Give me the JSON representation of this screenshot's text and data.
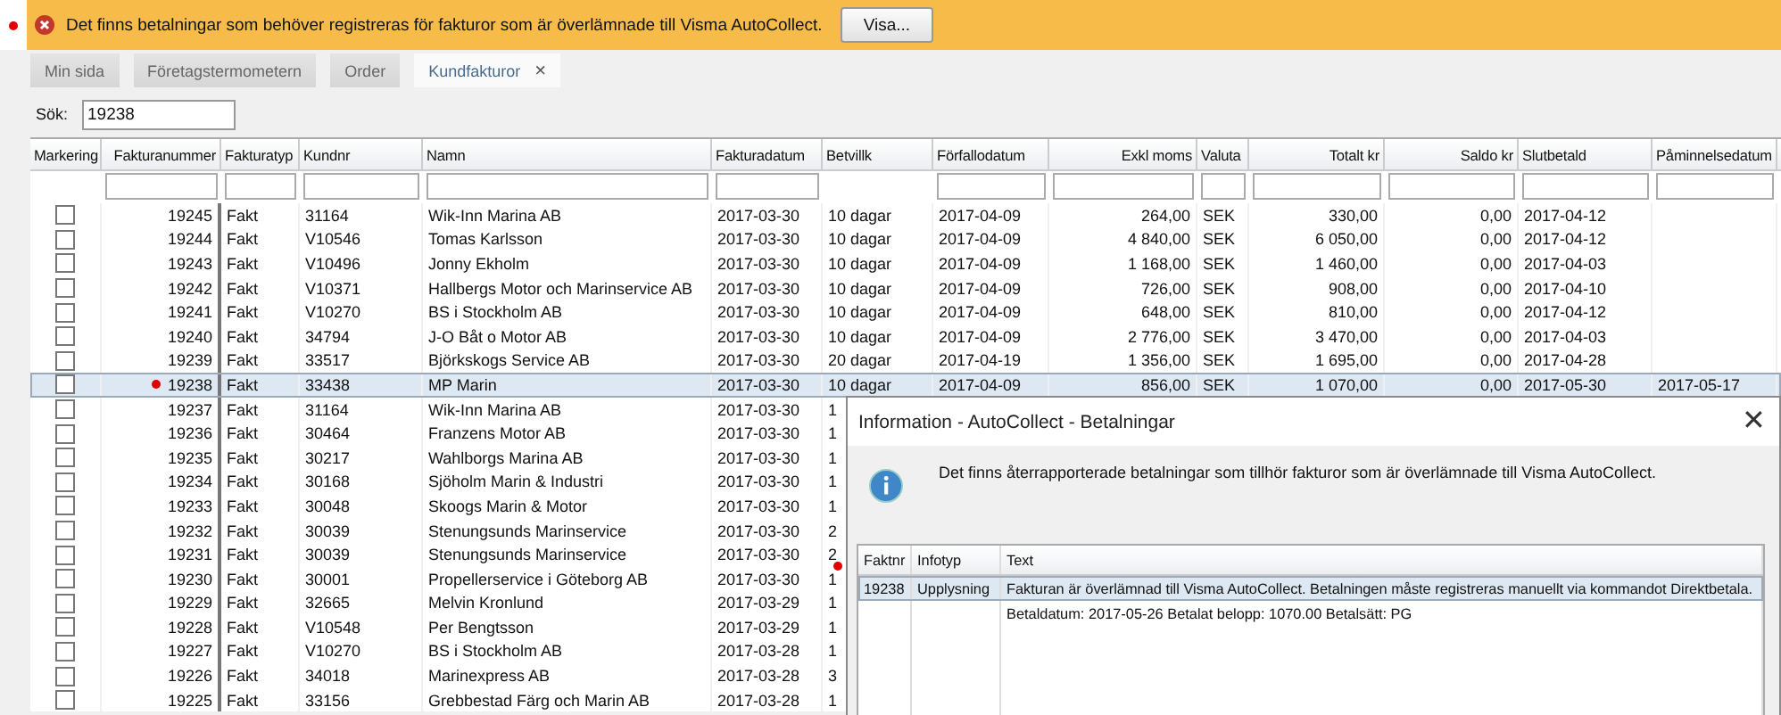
{
  "banner": {
    "flagged": true,
    "message": "Det finns betalningar som behöver registreras för fakturor som är överlämnade till Visma AutoCollect.",
    "button": "Visa..."
  },
  "tabs": [
    {
      "label": "Min sida",
      "selected": false
    },
    {
      "label": "Företagstermometern",
      "selected": false
    },
    {
      "label": "Order",
      "selected": false
    },
    {
      "label": "Kundfakturor",
      "selected": true,
      "close": "×"
    }
  ],
  "search": {
    "label": "Sök:",
    "value": "19238"
  },
  "table": {
    "check_column": "Markering",
    "columns": [
      {
        "label": "Fakturanummer",
        "kind": "number",
        "filter": true
      },
      {
        "label": "Fakturatyp",
        "kind": "text",
        "filter": true
      },
      {
        "label": "Kundnr",
        "kind": "text",
        "filter": true
      },
      {
        "label": "Namn",
        "kind": "text",
        "filter": true
      },
      {
        "label": "Fakturadatum",
        "kind": "text",
        "filter": true
      },
      {
        "label": "Betvillk",
        "kind": "text",
        "filter": false
      },
      {
        "label": "Förfallodatum",
        "kind": "text",
        "filter": true
      },
      {
        "label": "Exkl moms",
        "kind": "number",
        "filter": true
      },
      {
        "label": "Valuta",
        "kind": "text",
        "filter": true
      },
      {
        "label": "Totalt kr",
        "kind": "number",
        "filter": true
      },
      {
        "label": "Saldo kr",
        "kind": "number",
        "filter": true
      },
      {
        "label": "Slutbetald",
        "kind": "text",
        "filter": true
      },
      {
        "label": "Påminnelsedatum",
        "kind": "text",
        "filter": true
      }
    ],
    "rows": [
      {
        "checked": false,
        "selected": false,
        "flagged": false,
        "cells": [
          "19245",
          "Fakt",
          "31164",
          "Wik-Inn Marina AB",
          "2017-03-30",
          "10 dagar",
          "2017-04-09",
          "264,00",
          "SEK",
          "330,00",
          "0,00",
          "2017-04-12"
        ]
      },
      {
        "checked": false,
        "selected": false,
        "flagged": false,
        "cells": [
          "19244",
          "Fakt",
          "V10546",
          "Tomas Karlsson",
          "2017-03-30",
          "10 dagar",
          "2017-04-09",
          "4 840,00",
          "SEK",
          "6 050,00",
          "0,00",
          "2017-04-12"
        ]
      },
      {
        "checked": false,
        "selected": false,
        "flagged": false,
        "cells": [
          "19243",
          "Fakt",
          "V10496",
          "Jonny Ekholm",
          "2017-03-30",
          "10 dagar",
          "2017-04-09",
          "1 168,00",
          "SEK",
          "1 460,00",
          "0,00",
          "2017-04-03"
        ]
      },
      {
        "checked": false,
        "selected": false,
        "flagged": false,
        "cells": [
          "19242",
          "Fakt",
          "V10371",
          "Hallbergs Motor och Marinservice AB",
          "2017-03-30",
          "10 dagar",
          "2017-04-09",
          "726,00",
          "SEK",
          "908,00",
          "0,00",
          "2017-04-10"
        ]
      },
      {
        "checked": false,
        "selected": false,
        "flagged": false,
        "cells": [
          "19241",
          "Fakt",
          "V10270",
          "BS i Stockholm AB",
          "2017-03-30",
          "10 dagar",
          "2017-04-09",
          "648,00",
          "SEK",
          "810,00",
          "0,00",
          "2017-04-12"
        ]
      },
      {
        "checked": false,
        "selected": false,
        "flagged": false,
        "cells": [
          "19240",
          "Fakt",
          "34794",
          "J-O Båt o Motor AB",
          "2017-03-30",
          "10 dagar",
          "2017-04-09",
          "2 776,00",
          "SEK",
          "3 470,00",
          "0,00",
          "2017-04-03"
        ]
      },
      {
        "checked": false,
        "selected": false,
        "flagged": false,
        "cells": [
          "19239",
          "Fakt",
          "33517",
          "Björkskogs Service AB",
          "2017-03-30",
          "20 dagar",
          "2017-04-19",
          "1 356,00",
          "SEK",
          "1 695,00",
          "0,00",
          "2017-04-28"
        ]
      },
      {
        "checked": false,
        "selected": true,
        "flagged": true,
        "cells": [
          "19238",
          "Fakt",
          "33438",
          "MP Marin",
          "2017-03-30",
          "10 dagar",
          "2017-04-09",
          "856,00",
          "SEK",
          "1 070,00",
          "0,00",
          "2017-05-30",
          "2017-05-17"
        ]
      },
      {
        "checked": false,
        "selected": false,
        "flagged": false,
        "cells": [
          "19237",
          "Fakt",
          "31164",
          "Wik-Inn Marina AB",
          "2017-03-30",
          "1"
        ]
      },
      {
        "checked": false,
        "selected": false,
        "flagged": false,
        "cells": [
          "19236",
          "Fakt",
          "30464",
          "Franzens Motor AB",
          "2017-03-30",
          "1"
        ]
      },
      {
        "checked": false,
        "selected": false,
        "flagged": false,
        "cells": [
          "19235",
          "Fakt",
          "30217",
          "Wahlborgs Marina AB",
          "2017-03-30",
          "1"
        ]
      },
      {
        "checked": false,
        "selected": false,
        "flagged": false,
        "cells": [
          "19234",
          "Fakt",
          "30168",
          "Sjöholm Marin & Industri",
          "2017-03-30",
          "1"
        ]
      },
      {
        "checked": false,
        "selected": false,
        "flagged": false,
        "cells": [
          "19233",
          "Fakt",
          "30048",
          "Skoogs Marin & Motor",
          "2017-03-30",
          "1"
        ]
      },
      {
        "checked": false,
        "selected": false,
        "flagged": false,
        "cells": [
          "19232",
          "Fakt",
          "30039",
          "Stenungsunds Marinservice",
          "2017-03-30",
          "2"
        ]
      },
      {
        "checked": false,
        "selected": false,
        "flagged": false,
        "cells": [
          "19231",
          "Fakt",
          "30039",
          "Stenungsunds Marinservice",
          "2017-03-30",
          "2"
        ]
      },
      {
        "checked": false,
        "selected": false,
        "flagged": false,
        "cells": [
          "19230",
          "Fakt",
          "30001",
          "Propellerservice i Göteborg AB",
          "2017-03-30",
          "1"
        ]
      },
      {
        "checked": false,
        "selected": false,
        "flagged": false,
        "cells": [
          "19229",
          "Fakt",
          "32665",
          "Melvin Kronlund",
          "2017-03-29",
          "1"
        ]
      },
      {
        "checked": false,
        "selected": false,
        "flagged": false,
        "cells": [
          "19228",
          "Fakt",
          "V10548",
          "Per Bengtsson",
          "2017-03-29",
          "1"
        ]
      },
      {
        "checked": false,
        "selected": false,
        "flagged": false,
        "cells": [
          "19227",
          "Fakt",
          "V10270",
          "BS i Stockholm AB",
          "2017-03-28",
          "1"
        ]
      },
      {
        "checked": false,
        "selected": false,
        "flagged": false,
        "cells": [
          "19226",
          "Fakt",
          "34018",
          "Marinexpress AB",
          "2017-03-28",
          "3"
        ]
      },
      {
        "checked": false,
        "selected": false,
        "flagged": false,
        "cells": [
          "19225",
          "Fakt",
          "33156",
          "Grebbestad Färg och Marin AB",
          "2017-03-28",
          "1"
        ]
      }
    ]
  },
  "dialog": {
    "title": "Information - AutoCollect - Betalningar",
    "close": "✕",
    "message": "Det finns återrapporterade betalningar som tillhör fakturor som är överlämnade till Visma AutoCollect.",
    "columns": [
      "Faktnr",
      "Infotyp",
      "Text"
    ],
    "rows": [
      {
        "selected": true,
        "flagged": true,
        "faktnr": "19238",
        "infotyp": "Upplysning",
        "text": "Fakturan är överlämnad till Visma AutoCollect. Betalningen måste registreras manuellt via kommandot Direktbetala."
      },
      {
        "selected": false,
        "flagged": false,
        "text": "Betaldatum: 2017-05-26 Betalat belopp: 1070.00 Betalsätt: PG"
      }
    ]
  }
}
